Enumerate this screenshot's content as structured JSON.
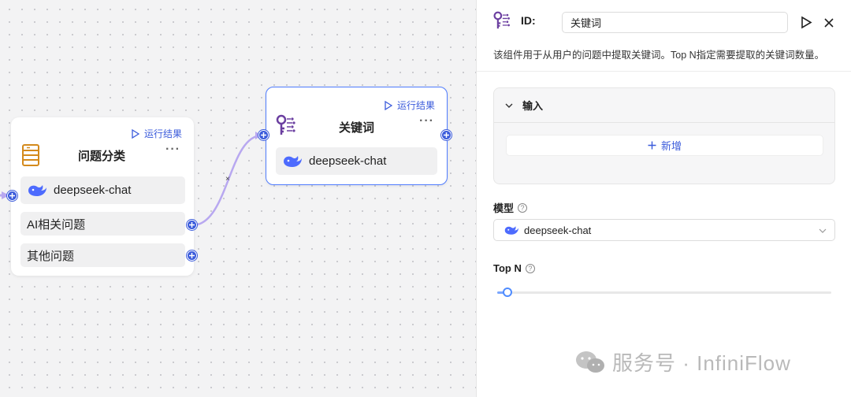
{
  "canvas": {
    "classify_node": {
      "run_label": "运行结果",
      "title": "问题分类",
      "more": "···",
      "model": "deepseek-chat",
      "categories": [
        "AI相关问题",
        "其他问题"
      ]
    },
    "keyword_node": {
      "run_label": "运行结果",
      "title": "关键词",
      "more": "···",
      "model": "deepseek-chat"
    },
    "edge_delete": "×"
  },
  "panel": {
    "id_label": "ID:",
    "id_value": "关键词",
    "description": "该组件用于从用户的问题中提取关键词。Top N指定需要提取的关键词数量。",
    "input_section": {
      "title": "输入",
      "add_label": "新增"
    },
    "model_label": "模型",
    "model_value": "deepseek-chat",
    "topn_label": "Top N",
    "topn_fraction": 0.03,
    "watermark": "服务号 · InfiniFlow"
  },
  "colors": {
    "accent": "#3b5bdb",
    "node_border": "#4f7cff",
    "icon_purple": "#6b3fa0",
    "icon_orange": "#d48a1c",
    "whale_blue": "#4d6bfe"
  },
  "icons": [
    "play-icon",
    "close-icon",
    "table-icon",
    "keyword-icon",
    "whale-icon",
    "chevron-down-icon",
    "plus-icon",
    "help-icon",
    "wechat-icon"
  ]
}
